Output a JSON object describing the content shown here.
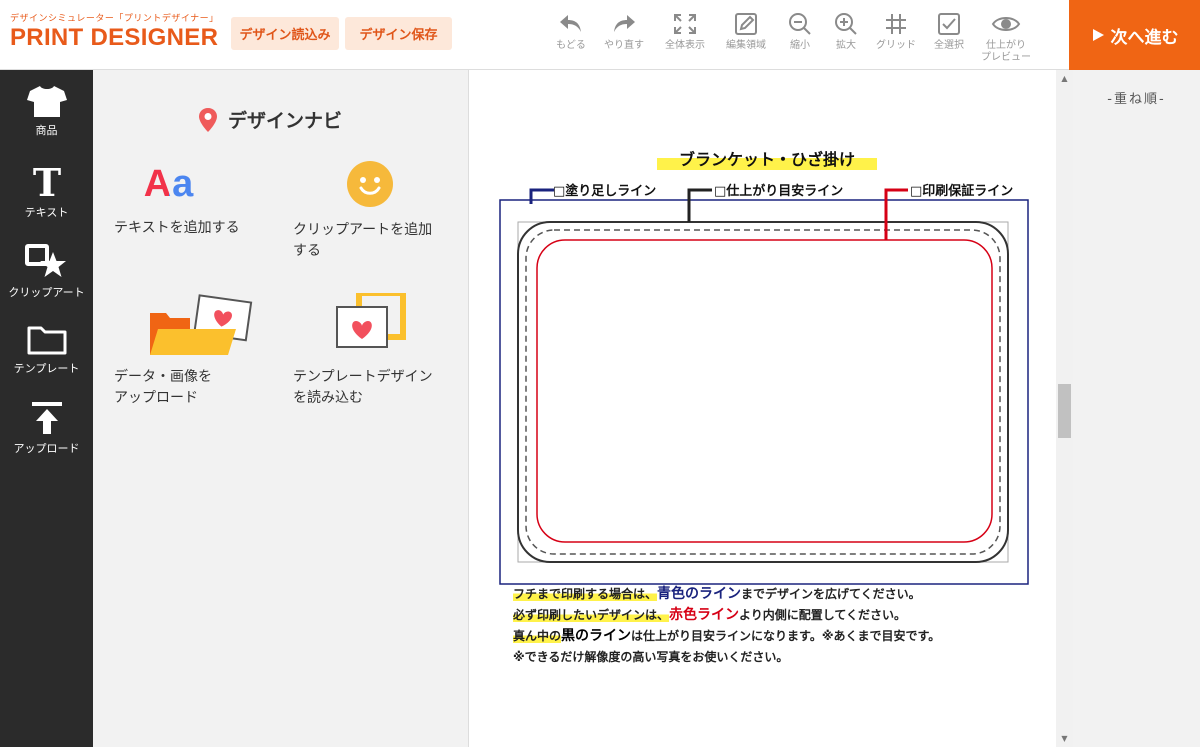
{
  "header": {
    "logo_sub": "デザインシミュレーター「プリントデザイナー」",
    "logo_main": "PRINT DESIGNER",
    "load_button": "デザイン読込み",
    "save_button": "デザイン保存",
    "tools": [
      {
        "label": "もどる",
        "icon": "undo-icon"
      },
      {
        "label": "やり直す",
        "icon": "redo-icon"
      },
      {
        "label": "全体表示",
        "icon": "fit-view-icon"
      },
      {
        "label": "編集領域",
        "icon": "edit-area-icon"
      },
      {
        "label": "縮小",
        "icon": "zoom-out-icon"
      },
      {
        "label": "拡大",
        "icon": "zoom-in-icon"
      },
      {
        "label": "グリッド",
        "icon": "grid-icon"
      },
      {
        "label": "全選択",
        "icon": "select-all-icon"
      },
      {
        "label_line1": "仕上がり",
        "label_line2": "プレビュー",
        "icon": "eye-icon"
      }
    ],
    "next_button": "次へ進む",
    "next_color": "#f06514"
  },
  "sidebar": {
    "items": [
      {
        "label": "商品",
        "icon": "tshirt-icon"
      },
      {
        "label": "テキスト",
        "icon": "text-icon"
      },
      {
        "label": "クリップアート",
        "icon": "clipart-icon"
      },
      {
        "label": "テンプレート",
        "icon": "folder-icon"
      },
      {
        "label": "アップロード",
        "icon": "upload-icon"
      }
    ]
  },
  "navi": {
    "title": "デザインナビ",
    "add_text_icon_text": "Aa",
    "items": [
      {
        "line1": "テキストを追加する",
        "line2": ""
      },
      {
        "line1": "クリップアートを追加",
        "line2": "する"
      },
      {
        "line1": "データ・画像を",
        "line2": "アップロード"
      },
      {
        "line1": "テンプレートデザイン",
        "line2": "を読み込む"
      }
    ]
  },
  "canvas": {
    "template_title": "ブランケット・ひざ掛け",
    "labels": {
      "bleed": "□塗り足しライン",
      "trim": "□仕上がり目安ライン",
      "safe": "□印刷保証ライン"
    },
    "colors": {
      "bleed": "#1a237e",
      "trim": "#222222",
      "safe": "#d60015"
    },
    "notes": {
      "line1_a": "フチまで印刷する場合は、",
      "line1_b": "青色のライン",
      "line1_c": "までデザインを広げてください。",
      "line2_a": "必ず印刷したいデザインは、",
      "line2_b": "赤色ライン",
      "line2_c": "より内側に配置してください。",
      "line3_a": "真ん中の",
      "line3_b": "黒のライン",
      "line3_c": "は仕上がり目安ラインになります。※あくまで目安です。",
      "line4": "※できるだけ解像度の高い写真をお使いください。"
    }
  },
  "layers": {
    "title": "-重ね順-"
  }
}
